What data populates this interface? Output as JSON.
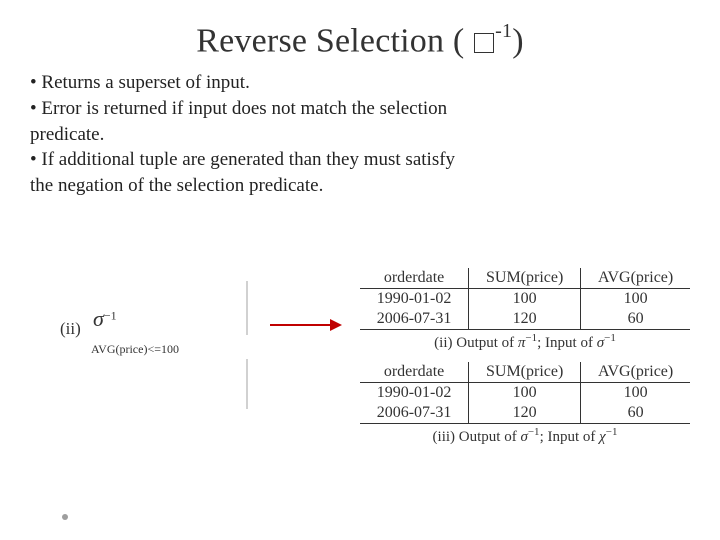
{
  "title": {
    "main": "Reverse Selection (",
    "sup": "-1",
    "close": ")"
  },
  "bullets": {
    "l1": "• Returns a superset of input.",
    "l2": "• Error is returned if input does not match the selection",
    "l3": "predicate.",
    "l4": "• If additional tuple are generated than they must satisfy",
    "l5": "the negation of the selection predicate."
  },
  "figure": {
    "left_roman": "(ii)",
    "sigma": "σ",
    "sigma_exp": "−1",
    "sigma_sub": "AVG(price)<=100",
    "table_headers": {
      "c1": "orderdate",
      "c2": "SUM(price)",
      "c3": "AVG(price)"
    },
    "table1": {
      "r1": {
        "c1": "1990-01-02",
        "c2": "100",
        "c3": "100"
      },
      "r2": {
        "c1": "2006-07-31",
        "c2": "120",
        "c3": "60"
      }
    },
    "caption1_a": "(ii) Output of ",
    "caption1_op": "π",
    "caption1_exp": "−1",
    "caption1_b": "; Input of ",
    "caption1_op2": "σ",
    "caption1_exp2": "−1",
    "table2": {
      "r1": {
        "c1": "1990-01-02",
        "c2": "100",
        "c3": "100"
      },
      "r2": {
        "c1": "2006-07-31",
        "c2": "120",
        "c3": "60"
      }
    },
    "caption2_a": "(iii) Output of ",
    "caption2_op": "σ",
    "caption2_exp": "−1",
    "caption2_b": "; Input of ",
    "caption2_op2": "χ",
    "caption2_exp2": "−1"
  }
}
